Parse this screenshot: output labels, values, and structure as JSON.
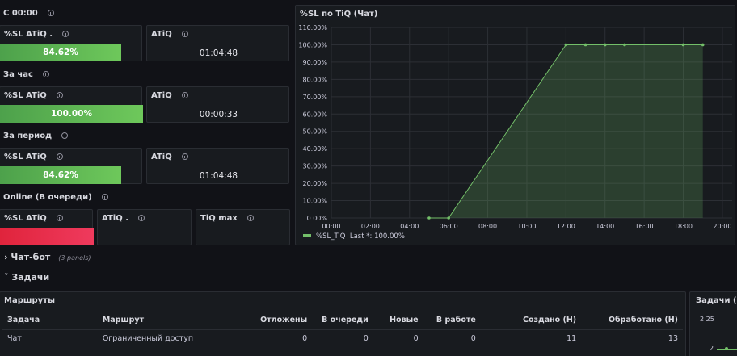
{
  "stats": {
    "since_midnight": {
      "label": "С 00:00",
      "sl_label": "%SL ATiQ .",
      "sl_value": "84.62%",
      "sl_fraction": 0.8462,
      "atiq_label": "ATiQ",
      "atiq_value": "01:04:48"
    },
    "last_hour": {
      "label": "За час",
      "sl_label": "%SL ATiQ",
      "sl_value": "100.00%",
      "sl_fraction": 1.0,
      "atiq_label": "ATiQ",
      "atiq_value": "00:00:33"
    },
    "period": {
      "label": "За период",
      "sl_label": "%SL ATiQ",
      "sl_value": "84.62%",
      "sl_fraction": 0.8462,
      "atiq_label": "ATiQ",
      "atiq_value": "01:04:48"
    },
    "online": {
      "label": "Online (В очереди)",
      "sl_label": "%SL ATiQ",
      "atiq_label": "ATiQ .",
      "tiq_label": "TiQ max"
    }
  },
  "chart_panel": {
    "title": "%SL по TiQ (Чат)",
    "legend_label": "%SL_TiQ",
    "legend_last": "Last *: 100.00%"
  },
  "chart_data": {
    "type": "area",
    "x_ticks": [
      "00:00",
      "02:00",
      "04:00",
      "06:00",
      "08:00",
      "10:00",
      "12:00",
      "14:00",
      "16:00",
      "18:00",
      "20:00"
    ],
    "y_ticks": [
      "0.00%",
      "10.00%",
      "20.00%",
      "30.00%",
      "40.00%",
      "50.00%",
      "60.00%",
      "70.00%",
      "80.00%",
      "90.00%",
      "100.00%",
      "110.00%"
    ],
    "ylim": [
      0,
      110
    ],
    "xlim_hours": [
      0,
      20.5
    ],
    "series": [
      {
        "name": "%SL_TiQ",
        "color": "#73bf69",
        "x_hours": [
          5,
          6,
          12,
          13,
          14,
          15,
          18,
          19
        ],
        "y": [
          0,
          0,
          100,
          100,
          100,
          100,
          100,
          100
        ]
      }
    ]
  },
  "sections": {
    "chatbot": {
      "label": "Чат-бот",
      "note": "(3 panels)"
    },
    "tasks": {
      "label": "Задачи"
    }
  },
  "routes_table": {
    "title": "Маршруты",
    "headers": [
      "Задача",
      "Маршрут",
      "Отложены",
      "В очереди",
      "Новые",
      "В работе",
      "Создано (Н)",
      "Обработано (Н)"
    ],
    "rows": [
      [
        "Чат",
        "Ограниченный доступ",
        "0",
        "0",
        "0",
        "0",
        "11",
        "13"
      ]
    ]
  },
  "side_panel": {
    "title": "Задачи (Ча",
    "y_tick_top": "2.25",
    "y_tick_mid": "2"
  },
  "colors": {
    "background": "#111217",
    "panel": "#181b1f",
    "green": "#73bf69",
    "red": "#e02f44"
  }
}
